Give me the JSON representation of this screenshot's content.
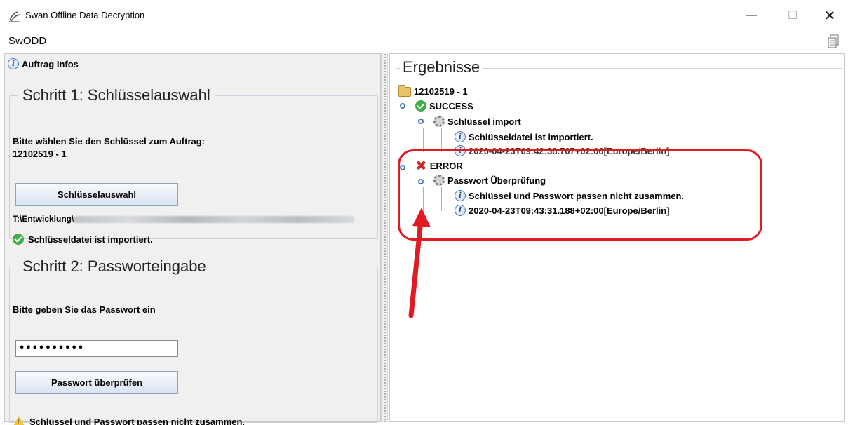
{
  "window": {
    "title": "Swan Offline Data Decryption",
    "app_short": "SwODD",
    "minimize": "—",
    "maximize": "☐",
    "close": "✕"
  },
  "left": {
    "info_label": "Auftrag Infos",
    "step1": {
      "legend": "Schritt 1: Schlüsselauswahl",
      "prompt_line1": "Bitte wählen Sie den Schlüssel zum Auftrag:",
      "prompt_line2": "12102519 - 1",
      "button": "Schlüsselauswahl",
      "path_prefix": "T:\\Entwicklung\\",
      "status": "Schlüsseldatei ist importiert."
    },
    "step2": {
      "legend": "Schritt 2: Passworteingabe",
      "prompt": "Bitte geben Sie das Passwort ein",
      "password_value": "••••••••••",
      "button": "Passwort überprüfen",
      "warning": "Schlüssel und Passwort passen nicht zusammen."
    }
  },
  "right": {
    "legend": "Ergebnisse",
    "tree": {
      "root": "12102519 - 1",
      "success": "SUCCESS",
      "key_import": "Schlüssel import",
      "key_import_msg": "Schlüsseldatei ist importiert.",
      "key_import_time": "2020-04-23T09:42:38.707+02:00[Europe/Berlin]",
      "error": "ERROR",
      "pw_check": "Passwort Überprüfung",
      "pw_check_msg": "Schlüssel und Passwort passen nicht zusammen.",
      "pw_check_time": "2020-04-23T09:43:31.188+02:00[Europe/Berlin]"
    }
  },
  "colors": {
    "highlight": "#e11b22",
    "success": "#3fae49",
    "error": "#d0272b"
  }
}
